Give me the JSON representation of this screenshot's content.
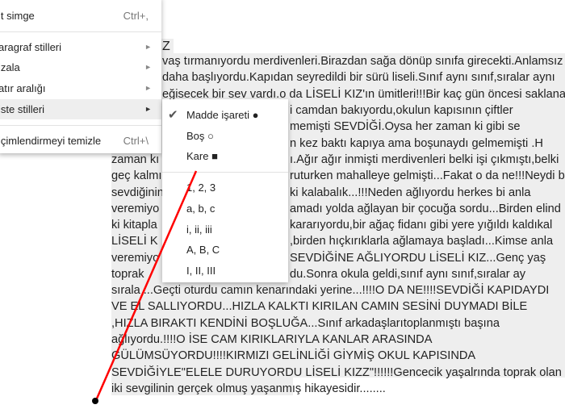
{
  "document": {
    "title_fragment": "Z",
    "lines": [
      {
        "left": "",
        "right": "vaş tırmanıyordu merdivenleri.Birazdan sağa dönüp sınıfa girecekti.Anlamsız"
      },
      {
        "left": "",
        "right": "daha başlıyordu.Kapıdan seyredildi bir sürü liseli.Sınıf aynı sınıf,sıralar aynı"
      },
      {
        "left": "",
        "right": "eğisecek bir sev vardı.o da LİSELİ KIZ'ın ümitleri!!!Bir kaç gün öncesi saklanan"
      },
      {
        "left": "",
        "right": "i camdan bakıyordu,okulun kapısının çiftler"
      },
      {
        "left": "",
        "right": "memişti SEVDİĞİ.Oysa her zaman ki gibi se"
      },
      {
        "left": "",
        "right": "n kez baktı kapıya ama boşunaydı gelmemişti .H"
      },
      {
        "left": "zaman kı",
        "right": "ı.Ağır ağır inmişti merdivenleri belki işi çıkmıştı,belki"
      },
      {
        "left": "geç kalmı",
        "right": "ruturken mahalleye gelmişti...Fakat o da ne!!!Neydi b"
      },
      {
        "left": "sevdiğinin",
        "right": "ki kalabalık...!!!Neden ağlıyordu herkes bi anla"
      },
      {
        "left": "veremiyo",
        "right": "amadı yolda ağlayan bir çocuğa sordu...Birden elind"
      },
      {
        "left": "ki kitapla",
        "right": "kararıyordu,bir ağaç fidanı gibi yere yığıldı kaldıkal"
      },
      {
        "left": "LİSELİ K",
        "right": ",birden hıçkırıklarla ağlamaya başladı...Kimse anla"
      },
      {
        "left": "veremiyo",
        "right": "SEVDİĞİNE AĞLIYORDU LİSELİ KIZ...Genç yaş"
      },
      {
        "left": "toprak",
        "right": "du.Sonra okula geldi,sınıf aynı sınıf,sıralar ay"
      },
      {
        "left": "sırala ...Geçti oturdu camın kenarındaki yerine...!!!!O DA NE!!!!SEVDİĞİ KAPIDAYDI",
        "right": ""
      },
      {
        "left": "VE EL SALLIYORDU...HIZLA KALKTI KIRILAN CAMIN SESİNİ DUYMADI BİLE",
        "right": ""
      },
      {
        "left": ",HIZLA BIRAKTI KENDİNİ BOŞLUĞA...Sınıf arkadaşlarıtoplanmıştı başına",
        "right": ""
      },
      {
        "left": "ağlıyordu.!!!!O İSE CAM KIRIKLARIYLA KANLAR ARASINDA",
        "right": ""
      },
      {
        "left": "GÜLÜMSÜYORDU!!!!KIRMIZI GELİNLİĞİ GİYMİŞ OKUL KAPISINDA",
        "right": ""
      },
      {
        "left": "SEVDİĞİYLE\"ELELE DURUYORDU LİSELİ KIZZ\"!!!!!!Gencecik yaşalrında toprak olan",
        "right": ""
      },
      {
        "left": "iki sevgilinin gerçek olmuş yaşanmış hikayesidir........",
        "right": ""
      }
    ]
  },
  "format_menu": {
    "items": [
      {
        "label": "lt simge",
        "shortcut": "Ctrl+,"
      },
      {
        "label": "aragraf stilleri",
        "submenu": true
      },
      {
        "label": "izala",
        "submenu": true
      },
      {
        "label": "atır aralığı",
        "submenu": true
      },
      {
        "label": "iste stilleri",
        "submenu": true,
        "active": true
      },
      {
        "label": "içimlendirmeyi temizle",
        "shortcut": "Ctrl+\\"
      }
    ]
  },
  "list_styles_submenu": {
    "bullets": [
      "Madde işareti ●",
      "Boş ○",
      "Kare ■"
    ],
    "checked": "Madde işareti ●",
    "numbered": [
      "1, 2, 3",
      "a, b, c",
      "i, ii, iii",
      "A, B, C",
      "I, II, III"
    ]
  },
  "annotation": {
    "arrow_color": "#ff0000"
  }
}
